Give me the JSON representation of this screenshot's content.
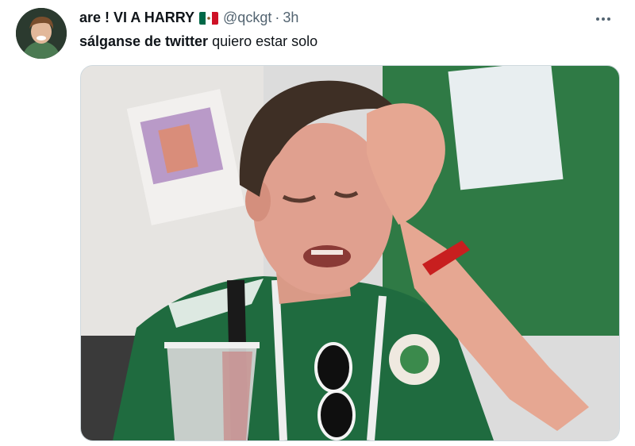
{
  "author": {
    "display_name": "are ! VI A HARRY",
    "handle": "@qckgt",
    "separator": "·",
    "time": "3h",
    "flag_icon": "mexico-flag-icon"
  },
  "tweet": {
    "text_bold": "sálganse de twitter",
    "text_rest": " quiero estar solo"
  },
  "media": {
    "description_icon": "crying-fan-photo"
  },
  "colors": {
    "text_primary": "#0f1419",
    "text_secondary": "#536471",
    "border": "#cfd9de",
    "flag_green": "#006847",
    "flag_white": "#ffffff",
    "flag_red": "#ce1126"
  }
}
